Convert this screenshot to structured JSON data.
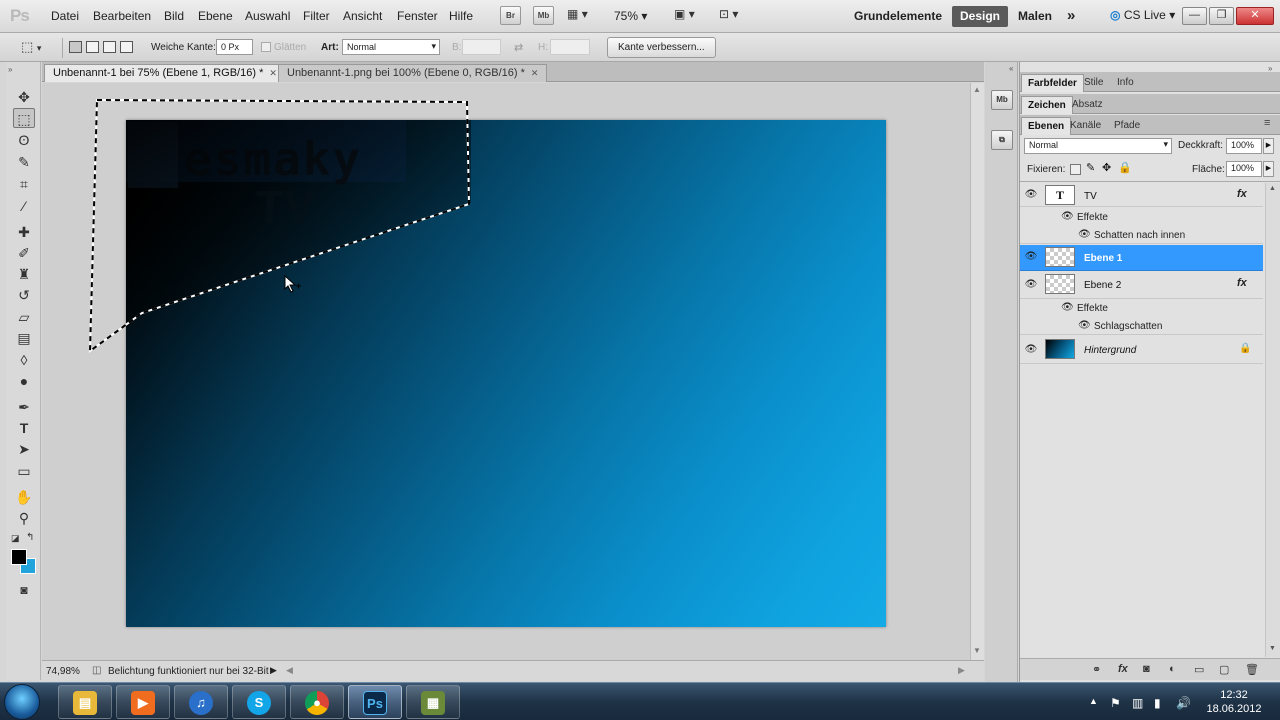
{
  "app": {
    "logo": "Ps"
  },
  "menu": [
    "Datei",
    "Bearbeiten",
    "Bild",
    "Ebene",
    "Auswahl",
    "Filter",
    "Ansicht",
    "Fenster",
    "Hilfe"
  ],
  "appbar": {
    "bridge": "Br",
    "mini_bridge": "Mb",
    "zoom": "75%",
    "workspaces": [
      "Grundelemente",
      "Design",
      "Malen"
    ],
    "active_workspace": "Design",
    "more": "»",
    "cslive": "CS Live"
  },
  "options": {
    "feather_label": "Weiche Kante:",
    "feather_value": "0 Px",
    "smooth_label": "Glätten",
    "style_label": "Art:",
    "style_value": "Normal",
    "width_label": "B:",
    "height_label": "H:",
    "refine_button": "Kante verbessern..."
  },
  "doc_tabs": [
    {
      "label": "Unbenannt-1 bei 75% (Ebene 1, RGB/16) *",
      "active": true
    },
    {
      "label": "Unbenannt-1.png bei 100% (Ebene 0, RGB/16) *",
      "active": false
    }
  ],
  "canvas": {
    "logo_text": "esmaky",
    "logo_sub": "TV"
  },
  "status": {
    "zoom": "74,98%",
    "message": "Belichtung funktioniert nur bei 32-Bit"
  },
  "panels": {
    "row1": [
      "Farbfelder",
      "Stile",
      "Info"
    ],
    "row2": [
      "Zeichen",
      "Absatz"
    ],
    "row3": [
      "Ebenen",
      "Kanäle",
      "Pfade"
    ],
    "blend_mode": "Normal",
    "opacity_label": "Deckkraft:",
    "opacity_value": "100%",
    "lock_label": "Fixieren:",
    "fill_label": "Fläche:",
    "fill_value": "100%"
  },
  "layers": [
    {
      "name": "TV",
      "type": "text",
      "fx": "fx",
      "effects_label": "Effekte",
      "effect": "Schatten nach innen"
    },
    {
      "name": "Ebene 1",
      "selected": true
    },
    {
      "name": "Ebene 2",
      "fx": "fx",
      "effects_label": "Effekte",
      "effect": "Schlagschatten"
    },
    {
      "name": "Hintergrund",
      "locked": true
    }
  ],
  "taskbar": {
    "apps": [
      "explorer-icon",
      "media-player-icon",
      "itunes-icon",
      "skype-icon",
      "chrome-icon",
      "photoshop-icon",
      "ut-icon"
    ],
    "time": "12:32",
    "date": "18.06.2012"
  },
  "colors": {
    "selection_blue": "#3399ff",
    "canvas_blue": "#0fa3e0",
    "workspace_active": "#5a5a5a"
  }
}
